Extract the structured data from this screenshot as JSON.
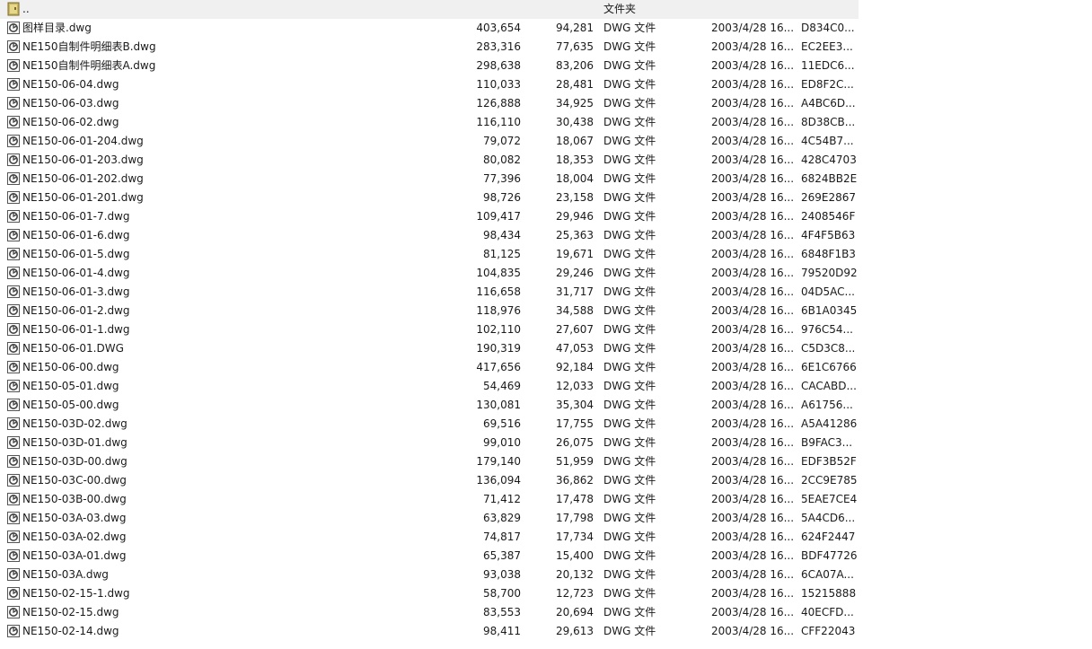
{
  "parent_row": {
    "name": "..",
    "type": "文件夹"
  },
  "files": [
    {
      "name": "图样目录.dwg",
      "size": "403,654",
      "packed": "94,281",
      "type": "DWG 文件",
      "modified": "2003/4/28 16...",
      "crc": "D834C0..."
    },
    {
      "name": "NE150自制件明细表B.dwg",
      "size": "283,316",
      "packed": "77,635",
      "type": "DWG 文件",
      "modified": "2003/4/28 16...",
      "crc": "EC2EE3..."
    },
    {
      "name": "NE150自制件明细表A.dwg",
      "size": "298,638",
      "packed": "83,206",
      "type": "DWG 文件",
      "modified": "2003/4/28 16...",
      "crc": "11EDC6..."
    },
    {
      "name": "NE150-06-04.dwg",
      "size": "110,033",
      "packed": "28,481",
      "type": "DWG 文件",
      "modified": "2003/4/28 16...",
      "crc": "ED8F2C..."
    },
    {
      "name": "NE150-06-03.dwg",
      "size": "126,888",
      "packed": "34,925",
      "type": "DWG 文件",
      "modified": "2003/4/28 16...",
      "crc": "A4BC6D..."
    },
    {
      "name": "NE150-06-02.dwg",
      "size": "116,110",
      "packed": "30,438",
      "type": "DWG 文件",
      "modified": "2003/4/28 16...",
      "crc": "8D38CB..."
    },
    {
      "name": "NE150-06-01-204.dwg",
      "size": "79,072",
      "packed": "18,067",
      "type": "DWG 文件",
      "modified": "2003/4/28 16...",
      "crc": "4C54B7..."
    },
    {
      "name": "NE150-06-01-203.dwg",
      "size": "80,082",
      "packed": "18,353",
      "type": "DWG 文件",
      "modified": "2003/4/28 16...",
      "crc": "428C4703"
    },
    {
      "name": "NE150-06-01-202.dwg",
      "size": "77,396",
      "packed": "18,004",
      "type": "DWG 文件",
      "modified": "2003/4/28 16...",
      "crc": "6824BB2E"
    },
    {
      "name": "NE150-06-01-201.dwg",
      "size": "98,726",
      "packed": "23,158",
      "type": "DWG 文件",
      "modified": "2003/4/28 16...",
      "crc": "269E2867"
    },
    {
      "name": "NE150-06-01-7.dwg",
      "size": "109,417",
      "packed": "29,946",
      "type": "DWG 文件",
      "modified": "2003/4/28 16...",
      "crc": "2408546F"
    },
    {
      "name": "NE150-06-01-6.dwg",
      "size": "98,434",
      "packed": "25,363",
      "type": "DWG 文件",
      "modified": "2003/4/28 16...",
      "crc": "4F4F5B63"
    },
    {
      "name": "NE150-06-01-5.dwg",
      "size": "81,125",
      "packed": "19,671",
      "type": "DWG 文件",
      "modified": "2003/4/28 16...",
      "crc": "6848F1B3"
    },
    {
      "name": "NE150-06-01-4.dwg",
      "size": "104,835",
      "packed": "29,246",
      "type": "DWG 文件",
      "modified": "2003/4/28 16...",
      "crc": "79520D92"
    },
    {
      "name": "NE150-06-01-3.dwg",
      "size": "116,658",
      "packed": "31,717",
      "type": "DWG 文件",
      "modified": "2003/4/28 16...",
      "crc": "04D5AC..."
    },
    {
      "name": "NE150-06-01-2.dwg",
      "size": "118,976",
      "packed": "34,588",
      "type": "DWG 文件",
      "modified": "2003/4/28 16...",
      "crc": "6B1A0345"
    },
    {
      "name": "NE150-06-01-1.dwg",
      "size": "102,110",
      "packed": "27,607",
      "type": "DWG 文件",
      "modified": "2003/4/28 16...",
      "crc": "976C54..."
    },
    {
      "name": "NE150-06-01.DWG",
      "size": "190,319",
      "packed": "47,053",
      "type": "DWG 文件",
      "modified": "2003/4/28 16...",
      "crc": "C5D3C8..."
    },
    {
      "name": "NE150-06-00.dwg",
      "size": "417,656",
      "packed": "92,184",
      "type": "DWG 文件",
      "modified": "2003/4/28 16...",
      "crc": "6E1C6766"
    },
    {
      "name": "NE150-05-01.dwg",
      "size": "54,469",
      "packed": "12,033",
      "type": "DWG 文件",
      "modified": "2003/4/28 16...",
      "crc": "CACABD..."
    },
    {
      "name": "NE150-05-00.dwg",
      "size": "130,081",
      "packed": "35,304",
      "type": "DWG 文件",
      "modified": "2003/4/28 16...",
      "crc": "A61756..."
    },
    {
      "name": "NE150-03D-02.dwg",
      "size": "69,516",
      "packed": "17,755",
      "type": "DWG 文件",
      "modified": "2003/4/28 16...",
      "crc": "A5A41286"
    },
    {
      "name": "NE150-03D-01.dwg",
      "size": "99,010",
      "packed": "26,075",
      "type": "DWG 文件",
      "modified": "2003/4/28 16...",
      "crc": "B9FAC3..."
    },
    {
      "name": "NE150-03D-00.dwg",
      "size": "179,140",
      "packed": "51,959",
      "type": "DWG 文件",
      "modified": "2003/4/28 16...",
      "crc": "EDF3B52F"
    },
    {
      "name": "NE150-03C-00.dwg",
      "size": "136,094",
      "packed": "36,862",
      "type": "DWG 文件",
      "modified": "2003/4/28 16...",
      "crc": "2CC9E785"
    },
    {
      "name": "NE150-03B-00.dwg",
      "size": "71,412",
      "packed": "17,478",
      "type": "DWG 文件",
      "modified": "2003/4/28 16...",
      "crc": "5EAE7CE4"
    },
    {
      "name": "NE150-03A-03.dwg",
      "size": "63,829",
      "packed": "17,798",
      "type": "DWG 文件",
      "modified": "2003/4/28 16...",
      "crc": "5A4CD6..."
    },
    {
      "name": "NE150-03A-02.dwg",
      "size": "74,817",
      "packed": "17,734",
      "type": "DWG 文件",
      "modified": "2003/4/28 16...",
      "crc": "624F2447"
    },
    {
      "name": "NE150-03A-01.dwg",
      "size": "65,387",
      "packed": "15,400",
      "type": "DWG 文件",
      "modified": "2003/4/28 16...",
      "crc": "BDF47726"
    },
    {
      "name": "NE150-03A.dwg",
      "size": "93,038",
      "packed": "20,132",
      "type": "DWG 文件",
      "modified": "2003/4/28 16...",
      "crc": "6CA07A..."
    },
    {
      "name": "NE150-02-15-1.dwg",
      "size": "58,700",
      "packed": "12,723",
      "type": "DWG 文件",
      "modified": "2003/4/28 16...",
      "crc": "15215888"
    },
    {
      "name": "NE150-02-15.dwg",
      "size": "83,553",
      "packed": "20,694",
      "type": "DWG 文件",
      "modified": "2003/4/28 16...",
      "crc": "40ECFD..."
    },
    {
      "name": "NE150-02-14.dwg",
      "size": "98,411",
      "packed": "29,613",
      "type": "DWG 文件",
      "modified": "2003/4/28 16...",
      "crc": "CFF22043"
    }
  ],
  "icons": {
    "parent": "folder-up-icon",
    "file": "dwg-file-icon"
  },
  "colors": {
    "parent_row_bg": "#f0f0f0",
    "text": "#1a1a1a",
    "parent_accent": "#49a5e6"
  }
}
